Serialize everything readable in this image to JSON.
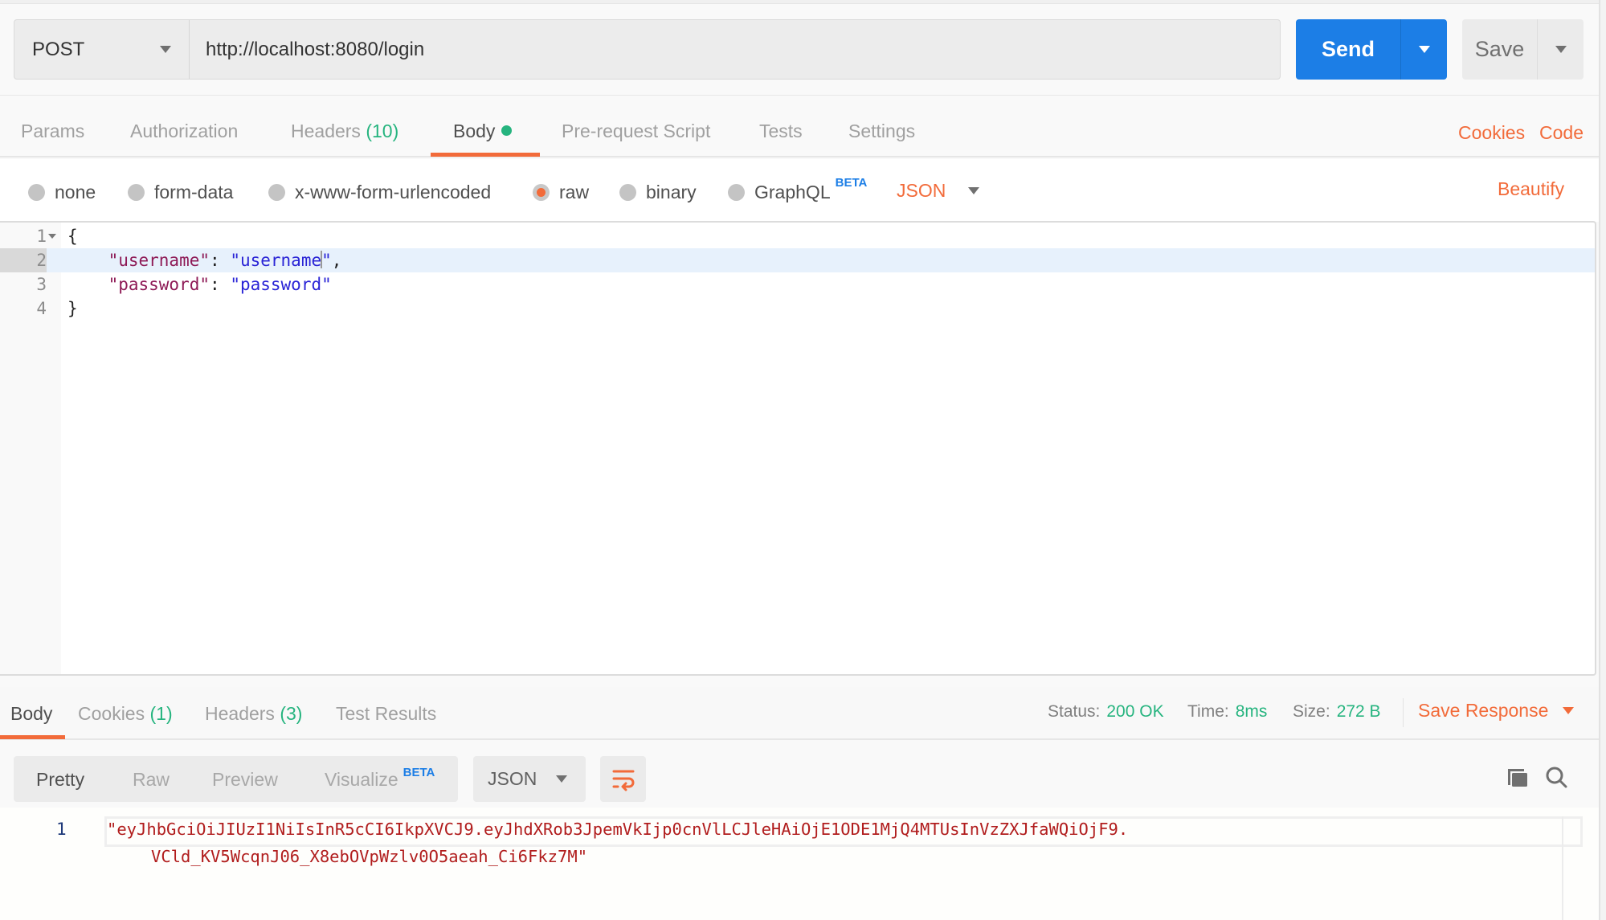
{
  "request": {
    "method": "POST",
    "url": "http://localhost:8080/login",
    "send_label": "Send",
    "save_label": "Save"
  },
  "request_tabs": [
    {
      "label": "Params"
    },
    {
      "label": "Authorization"
    },
    {
      "label": "Headers",
      "count": "(10)"
    },
    {
      "label": "Body",
      "active": true,
      "has_content_dot": true
    },
    {
      "label": "Pre-request Script"
    },
    {
      "label": "Tests"
    },
    {
      "label": "Settings"
    }
  ],
  "request_links": {
    "cookies": "Cookies",
    "code": "Code"
  },
  "body_types": [
    {
      "label": "none"
    },
    {
      "label": "form-data"
    },
    {
      "label": "x-www-form-urlencoded"
    },
    {
      "label": "raw",
      "selected": true
    },
    {
      "label": "binary"
    },
    {
      "label": "GraphQL",
      "badge": "BETA"
    }
  ],
  "raw_format": "JSON",
  "beautify_label": "Beautify",
  "editor": {
    "lines": [
      {
        "number": "1",
        "foldable": true
      },
      {
        "number": "2",
        "key": "\"username\"",
        "value": "\"username\"",
        "trailing": ","
      },
      {
        "number": "3",
        "key": "\"password\"",
        "value": "\"password\""
      },
      {
        "number": "4"
      }
    ],
    "open_brace": "{",
    "close_brace": "}",
    "colon": ": "
  },
  "response_tabs": [
    {
      "label": "Body",
      "active": true
    },
    {
      "label": "Cookies",
      "count": "(1)"
    },
    {
      "label": "Headers",
      "count": "(3)"
    },
    {
      "label": "Test Results"
    }
  ],
  "response_status": {
    "status_label": "Status:",
    "status_value": "200 OK",
    "time_label": "Time:",
    "time_value": "8ms",
    "size_label": "Size:",
    "size_value": "272 B",
    "save_response_label": "Save Response"
  },
  "response_view": {
    "options": [
      {
        "label": "Pretty",
        "active": true
      },
      {
        "label": "Raw"
      },
      {
        "label": "Preview"
      },
      {
        "label": "Visualize",
        "badge": "BETA"
      }
    ],
    "format": "JSON",
    "icons": [
      "wrap-lines-icon",
      "copy-icon",
      "search-icon"
    ]
  },
  "response_body": {
    "line_number": "1",
    "line_part1": "\"eyJhbGciOiJIUzI1NiIsInR5cCI6IkpXVCJ9.eyJhdXRob3JpemVkIjp0cnVlLCJleHAiOjE1ODE1MjQ4MTUsInVzZXJfaWQiOjF9.",
    "line_part2": "VCld_KV5WcqnJ06_X8ebOVpWzlv0O5aeah_Ci6Fkz7M\""
  },
  "colors": {
    "accent_orange": "#f26b3a",
    "send_blue": "#1c7ee6",
    "success_green": "#26b47f",
    "json_key": "#8e1a56",
    "json_string": "#2a24d6",
    "response_string": "#b11d1d"
  }
}
